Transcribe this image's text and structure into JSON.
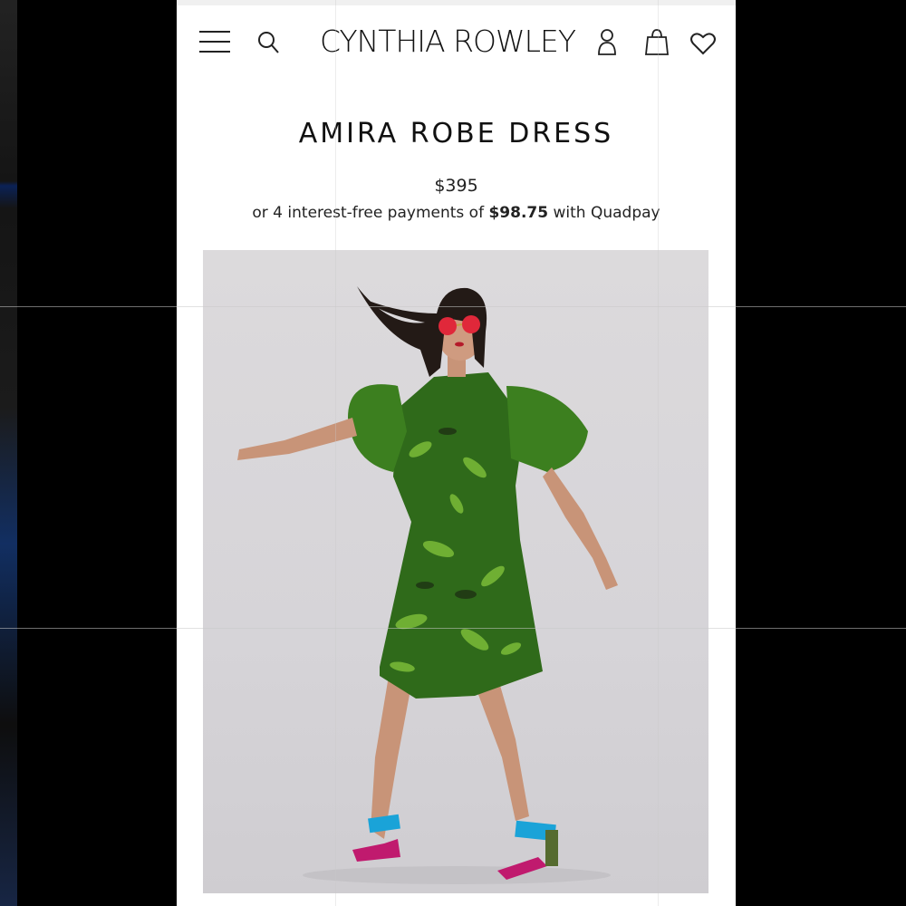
{
  "header": {
    "brand": "CYNTHIA ROWLEY",
    "menu_icon": "hamburger-menu-icon",
    "search_icon": "search-icon",
    "account_icon": "account-icon",
    "bag_icon": "shopping-bag-icon",
    "wishlist_icon": "heart-icon"
  },
  "product": {
    "title": "AMIRA ROBE DRESS",
    "price": "$395",
    "installment_prefix": "or 4 interest-free payments of",
    "installment_amount": "$98.75",
    "installment_suffix": "with Quadpay",
    "image_alt": "Model wearing green tropical print robe dress with red sunglasses and blue strap heels"
  },
  "colors": {
    "background": "#000000",
    "page": "#ffffff",
    "text": "#111111",
    "dress_green": "#3f7a1f",
    "sunglasses_red": "#e0283a",
    "shoe_blue": "#1aa3d8"
  }
}
